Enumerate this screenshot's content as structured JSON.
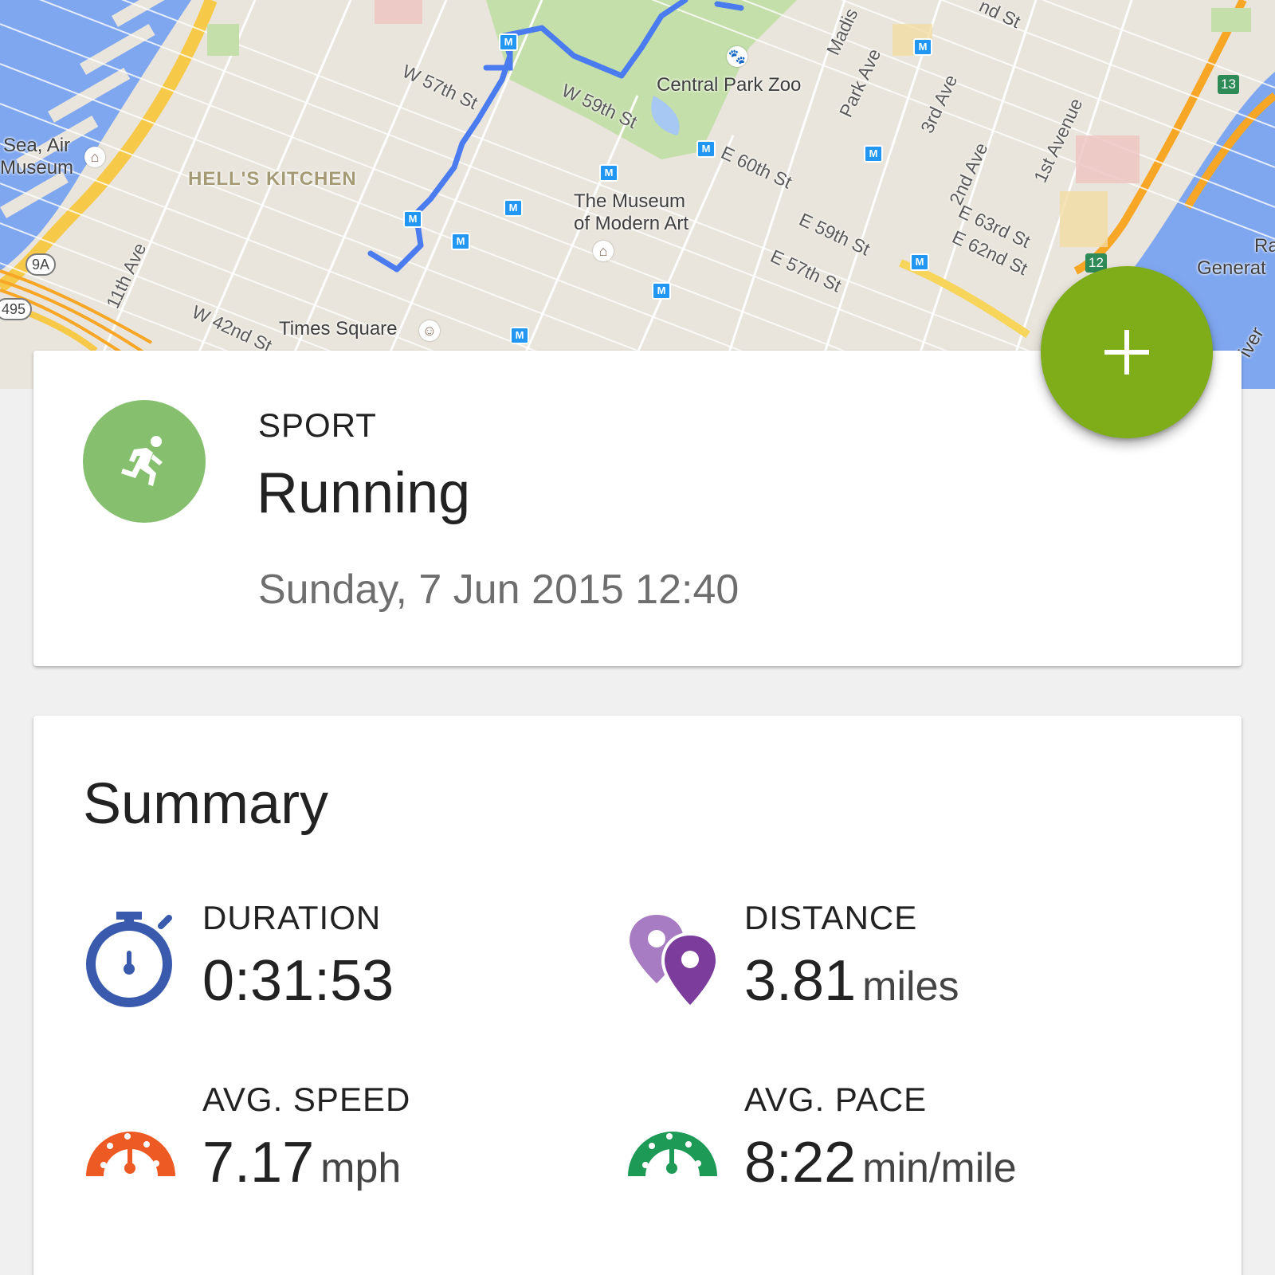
{
  "map": {
    "streets": [
      "W 57th St",
      "W 59th St",
      "E 60th St",
      "E 59th St",
      "E 57th St",
      "E 63rd St",
      "E 62nd St",
      "W 42nd St",
      "11th Ave",
      "Park Ave",
      "3rd Ave",
      "2nd Ave",
      "1st Avenue",
      "Madis",
      "nd St"
    ],
    "places": {
      "central_park_zoo": "Central Park Zoo",
      "moma_line1": "The Museum",
      "moma_line2": "of Modern Art",
      "times_square": "Times Square",
      "hells_kitchen": "HELL'S KITCHEN",
      "intrepid_line1": "Sea, Air",
      "intrepid_line2": "Museum",
      "ravenswood_line1": "Ra",
      "ravenswood_line2": "Generat",
      "river": "iver"
    },
    "shields": [
      "9A",
      "495"
    ],
    "exits": [
      "13",
      "12"
    ],
    "metro_label": "M",
    "route_color": "#4a7cf0"
  },
  "sport": {
    "label": "SPORT",
    "value": "Running",
    "date": "Sunday, 7 Jun 2015 12:40",
    "icon": "running-person-icon",
    "color": "#86c06f"
  },
  "fab": {
    "icon": "plus-icon",
    "color": "#7fad1a"
  },
  "summary": {
    "title": "Summary",
    "metrics": [
      {
        "label": "DURATION",
        "value": "0:31:53",
        "unit": "",
        "icon": "stopwatch-icon",
        "color": "#3a5bad"
      },
      {
        "label": "DISTANCE",
        "value": "3.81",
        "unit": "miles",
        "icon": "location-pins-icon",
        "color": "#7b3c9c"
      },
      {
        "label": "AVG. SPEED",
        "value": "7.17",
        "unit": "mph",
        "icon": "speedometer-icon",
        "color": "#ee5a24"
      },
      {
        "label": "AVG. PACE",
        "value": "8:22",
        "unit": "min/mile",
        "icon": "pace-gauge-icon",
        "color": "#1e9a57"
      }
    ]
  }
}
